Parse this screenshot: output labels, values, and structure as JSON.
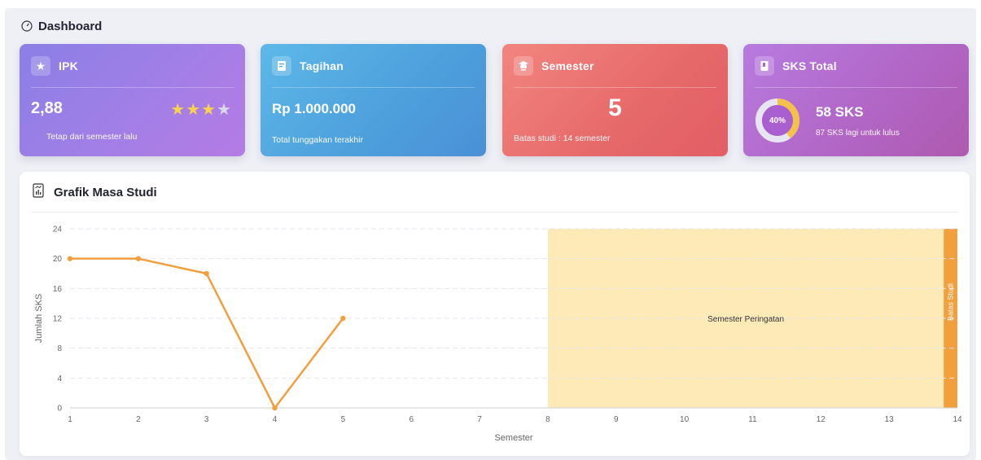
{
  "header": {
    "title": "Dashboard",
    "icon": "speedometer-icon"
  },
  "cards": {
    "ipk": {
      "title": "IPK",
      "icon": "star-icon",
      "value": "2,88",
      "stars_filled": 3,
      "stars_total": 4,
      "subtitle": "Tetap dari semester lalu",
      "colors": [
        "#8a7fe6",
        "#b47be4"
      ]
    },
    "tagihan": {
      "title": "Tagihan",
      "icon": "invoice-icon",
      "value": "Rp 1.000.000",
      "subtitle": "Total tunggakan terakhir",
      "colors": [
        "#5db8e8",
        "#4a90d6"
      ]
    },
    "semester": {
      "title": "Semester",
      "icon": "graduation-cap-icon",
      "value": "5",
      "subtitle": "Batas studi : 14 semester",
      "colors": [
        "#f2857f",
        "#e25e65"
      ]
    },
    "sks": {
      "title": "SKS Total",
      "icon": "book-icon",
      "value": "58 SKS",
      "progress_label": "40%",
      "progress": 0.4,
      "subtitle": "87 SKS lagi untuk lulus",
      "colors": [
        "#b77be0",
        "#ae5aaf"
      ],
      "ring_color": "#f4c24a"
    }
  },
  "chart_panel": {
    "title": "Grafik Masa Studi",
    "icon": "chart-document-icon"
  },
  "chart_data": {
    "type": "line",
    "xlabel": "Semester",
    "ylabel": "Jumlah SKS",
    "xlim": [
      1,
      14
    ],
    "ylim": [
      0,
      24
    ],
    "x_ticks": [
      1,
      2,
      3,
      4,
      5,
      6,
      7,
      8,
      9,
      10,
      11,
      12,
      13,
      14
    ],
    "y_ticks": [
      0,
      4,
      8,
      12,
      16,
      20,
      24
    ],
    "series": [
      {
        "x": [
          1,
          2,
          3,
          4,
          5
        ],
        "values": [
          20,
          20,
          18,
          0,
          12
        ],
        "color": "#f29f3d"
      }
    ],
    "grid": "horizontal-dashed",
    "annotations": [
      {
        "type": "band",
        "x_start": 8,
        "x_end": 14,
        "label": "Semester Peringatan",
        "color": "#fdeab6"
      },
      {
        "type": "band",
        "x_start": 13.8,
        "x_end": 14,
        "label": "Batas Studi",
        "color": "#f29f3d"
      }
    ]
  }
}
